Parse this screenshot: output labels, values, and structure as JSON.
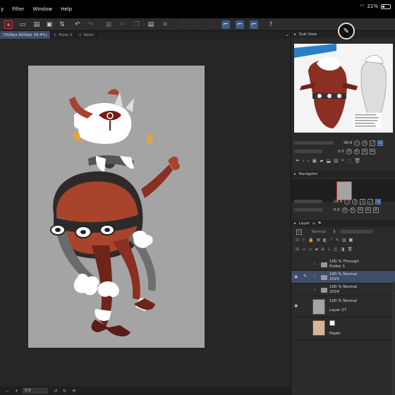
{
  "menu": {
    "items": [
      "y",
      "Filter",
      "Window",
      "Help"
    ]
  },
  "status": {
    "battery": "21%"
  },
  "tabs": [
    {
      "label": "7926px 600dpi 18.4%)",
      "active": true
    },
    {
      "label": "Punn 2",
      "active": false
    },
    {
      "label": "Korin",
      "active": false
    }
  ],
  "subview": {
    "title": "Sub View",
    "zoom": "48.8",
    "angle": "0.0"
  },
  "navigator": {
    "title": "Navigator",
    "zoom": "18.4",
    "angle": "0.0"
  },
  "layer_panel": {
    "title": "Layer",
    "blend_mode": "Normal",
    "layers": [
      {
        "line1": "100 % Through",
        "line2": "Folder 1",
        "type": "folder",
        "visible": false,
        "selected": false
      },
      {
        "line1": "100 % Normal",
        "line2": "2025",
        "type": "folder",
        "visible": true,
        "selected": true
      },
      {
        "line1": "100 % Normal",
        "line2": "2024",
        "type": "folder",
        "visible": false,
        "selected": false
      },
      {
        "line1": "100 % Normal",
        "line2": "Layer 27",
        "type": "raster",
        "visible": true,
        "selected": false
      },
      {
        "line1": "",
        "line2": "Paper",
        "type": "paper",
        "visible": false,
        "selected": false
      }
    ]
  },
  "bottom": {
    "zoom_value": "0.0"
  },
  "colors": {
    "accent": "#3d5a8a",
    "canvas": "#a4a4a4",
    "paper": "#d8b597"
  }
}
